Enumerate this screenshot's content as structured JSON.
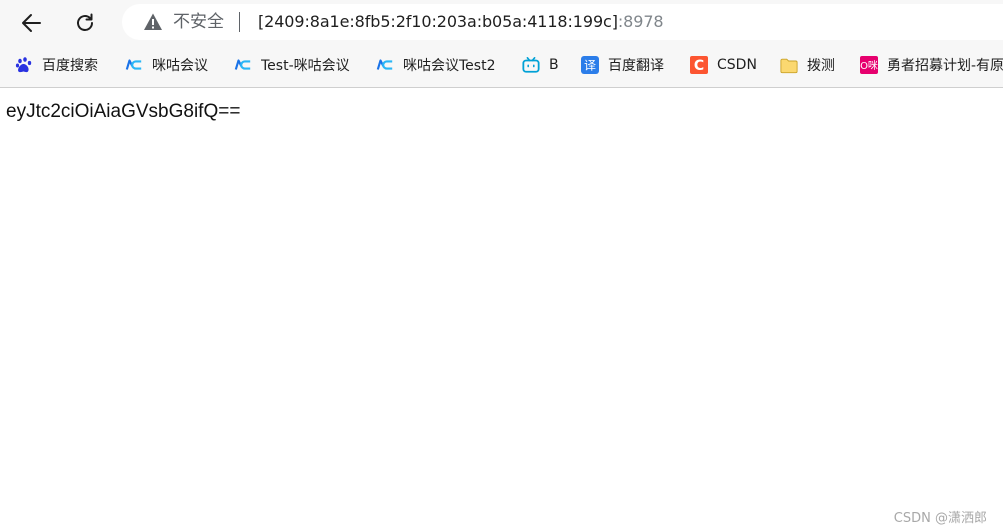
{
  "browser": {
    "address_bar": {
      "security_label": "不安全",
      "url_host": "[2409:8a1e:8fb5:2f10:203a:b05a:4118:199c]",
      "url_port": ":8978"
    },
    "bookmarks": [
      {
        "label": "百度搜索",
        "icon": "baidu-paw-icon"
      },
      {
        "label": "咪咕会议",
        "icon": "migu-meeting-icon"
      },
      {
        "label": "Test-咪咕会议",
        "icon": "migu-meeting-icon"
      },
      {
        "label": "咪咕会议Test2",
        "icon": "migu-meeting-icon"
      },
      {
        "label": "B",
        "icon": "bilibili-tv-icon"
      },
      {
        "label": "百度翻译",
        "icon": "translate-icon"
      },
      {
        "label": "CSDN",
        "icon": "csdn-icon"
      },
      {
        "label": "拨测",
        "icon": "folder-icon"
      },
      {
        "label": "勇者招募计划-有原",
        "icon": "migu-logo-icon"
      }
    ]
  },
  "page": {
    "body_text": "eyJtc2ciOiAiaGVsbG8ifQ=="
  },
  "watermark": "CSDN @潇洒郎",
  "colors": {
    "toolbar_bg": "#f7f7f7",
    "addressbar_bg": "#ffffff",
    "warning_icon": "#5f6368",
    "port_text": "#80868b",
    "migu_blue": "#1a73e8",
    "translate_blue": "#2b7de9",
    "csdn_red": "#fc5531",
    "folder_yellow": "#f5c542",
    "migu_pink": "#e6006e"
  }
}
